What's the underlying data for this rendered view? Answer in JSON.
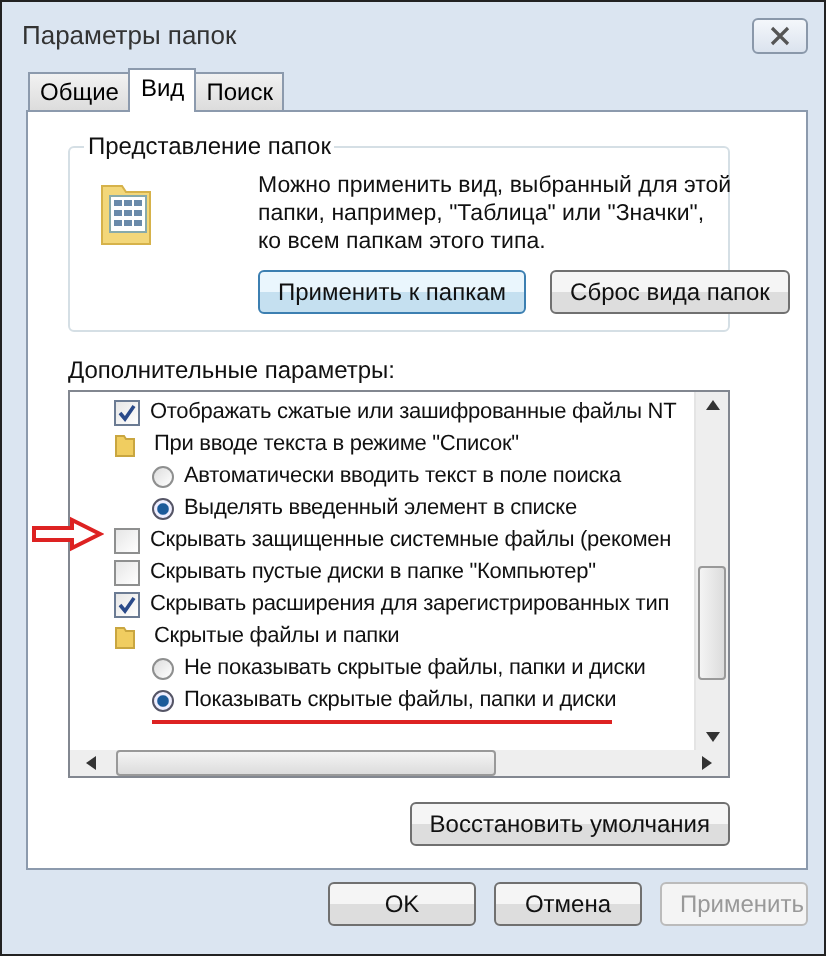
{
  "window": {
    "title": "Параметры папок"
  },
  "tabs": [
    {
      "label": "Общие",
      "selected": false
    },
    {
      "label": "Вид",
      "selected": true
    },
    {
      "label": "Поиск",
      "selected": false
    }
  ],
  "folder_views": {
    "title": "Представление папок",
    "description_lines": [
      "Можно применить вид, выбранный для этой",
      "папки, например, \"Таблица\" или \"Значки\",",
      "ко всем папкам этого типа."
    ],
    "buttons": [
      "Применить к папкам",
      "Сброс вида папок"
    ]
  },
  "advanced": {
    "title": "Дополнительные параметры:",
    "items": [
      {
        "kind": "checkbox",
        "label": "Отображать сжатые или зашифрованные файлы NT",
        "checked": true,
        "marked": false
      },
      {
        "kind": "folder",
        "label": "При вводе текста в режиме \"Список\"",
        "children": [
          {
            "kind": "radio",
            "label": "Автоматически вводить текст в поле поиска",
            "selected": false,
            "underlined": false
          },
          {
            "kind": "radio",
            "label": "Выделять введенный элемент в списке",
            "selected": true,
            "underlined": false
          }
        ]
      },
      {
        "kind": "checkbox",
        "label": "Скрывать защищенные системные файлы (рекомен",
        "checked": false,
        "marked": true
      },
      {
        "kind": "checkbox",
        "label": "Скрывать пустые диски в папке \"Компьютер\"",
        "checked": false,
        "marked": false
      },
      {
        "kind": "checkbox",
        "label": "Скрывать расширения для зарегистрированных тип",
        "checked": true,
        "marked": false
      },
      {
        "kind": "folder",
        "label": "Скрытые файлы и папки",
        "children": [
          {
            "kind": "radio",
            "label": "Не показывать скрытые файлы, папки и диски",
            "selected": false,
            "underlined": false
          },
          {
            "kind": "radio",
            "label": "Показывать скрытые файлы, папки и диски",
            "selected": true,
            "underlined": true
          }
        ]
      }
    ],
    "restore_button": "Восстановить умолчания"
  },
  "buttons": [
    {
      "label": "OK",
      "disabled": false
    },
    {
      "label": "Отмена",
      "disabled": false
    },
    {
      "label": "Применить",
      "disabled": true
    }
  ]
}
